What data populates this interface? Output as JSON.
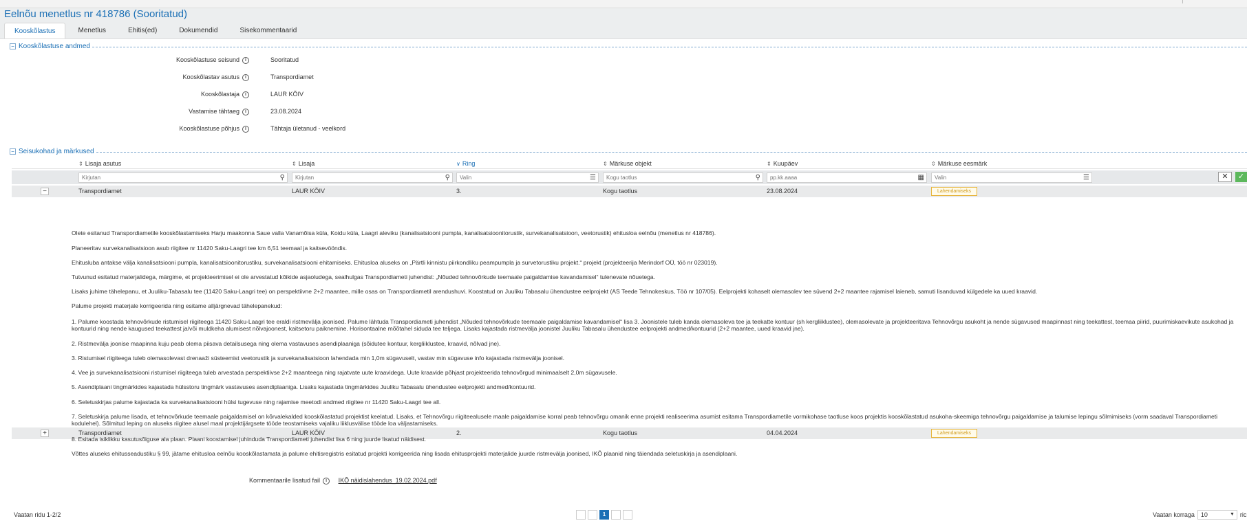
{
  "title": "Eelnõu menetlus nr 418786 (Sooritatud)",
  "tabs": [
    "Kooskõlastus",
    "Menetlus",
    "Ehitis(ed)",
    "Dokumendid",
    "Sisekommentaarid"
  ],
  "section1": {
    "title": "Kooskõlastuse andmed",
    "rows": [
      {
        "label": "Kooskõlastuse seisund",
        "value": "Sooritatud"
      },
      {
        "label": "Kooskõlastav asutus",
        "value": "Transpordiamet"
      },
      {
        "label": "Kooskõlastaja",
        "value": "LAUR KÕIV"
      },
      {
        "label": "Vastamise tähtaeg",
        "value": "23.08.2024"
      },
      {
        "label": "Kooskõlastuse põhjus",
        "value": "Tähtaja ületanud - veelkord"
      }
    ]
  },
  "section2": {
    "title": "Seisukohad ja märkused"
  },
  "columns": [
    "Lisaja asutus",
    "Lisaja",
    "Ring",
    "Märkuse objekt",
    "Kuupäev",
    "Märkuse eesmärk"
  ],
  "filters": [
    {
      "placeholder": "Kirjutan",
      "icon": "search-icon"
    },
    {
      "placeholder": "Kirjutan",
      "icon": "search-icon"
    },
    {
      "placeholder": "Valin",
      "icon": "list-icon"
    },
    {
      "placeholder": "Kogu taotlus",
      "icon": "search-icon"
    },
    {
      "placeholder": "pp.kk.aaaa",
      "icon": "calendar-icon"
    },
    {
      "placeholder": "Valin",
      "icon": "list-icon"
    }
  ],
  "rows": [
    {
      "toggle": "−",
      "asutus": "Transpordiamet",
      "lisaja": "LAUR KÕIV",
      "ring": "3.",
      "objekt": "Kogu taotlus",
      "kuupaev": "23.08.2024",
      "eesmark": "Lahendamiseks"
    },
    {
      "toggle": "+",
      "asutus": "Transpordiamet",
      "lisaja": "LAUR KÕIV",
      "ring": "2.",
      "objekt": "Kogu taotlus",
      "kuupaev": "04.04.2024",
      "eesmark": "Lahendamiseks"
    }
  ],
  "comment": [
    "Olete esitanud Transpordiametile kooskõlastamiseks Harju maakonna Saue valla Vanamõisa küla, Koidu küla, Laagri aleviku (kanalisatsiooni pumpla, kanalisatsioonitorustik, survekanalisatsioon, veetorustik) ehitusloa eelnõu (menetlus nr 418786).",
    "Planeeritav survekanalisatsioon asub riigitee nr 11420 Saku-Laagri tee km 6,51 teemaal ja kaitsevööndis.",
    "Ehitusluba antakse välja kanalisatsiooni pumpla, kanalisatsioonitorustiku, survekanalisatsiooni ehitamiseks. Ehitusloa aluseks on „Pärtli kinnistu piirkondliku peampumpla ja survetorustiku projekt.“ projekt (projekteerija Merindorf OÜ, töö nr 023019).",
    "Tutvunud esitatud materjalidega, märgime, et projekteerimisel ei ole arvestatud kõikide asjaoludega, sealhulgas Transpordiameti juhendist: „Nõuded tehnovõrkude teemaale paigaldamise kavandamisel“ tulenevate nõuetega.",
    "Lisaks juhime tähelepanu, et Juuliku-Tabasalu tee (11420 Saku-Laagri tee) on perspektiivne 2+2 maantee, mille osas on Transpordiametil arendushuvi. Koostatud on Juuliku Tabasalu ühendustee eelprojekt (AS Teede Tehnokeskus, Töö nr 107/05). Eelprojekti kohaselt olemasolev tee süvend 2+2 maantee rajamisel laieneb, samuti lisanduvad külgedele ka uued kraavid.",
    "Palume projekti materjale korrigeerida ning esitame alljärgnevad tähelepanekud:",
    "1.  Palume koostada tehnovõrkude ristumisel riigiteega 11420 Saku-Laagri tee eraldi ristmevälja joonised. Palume lähtuda Transpordiameti juhendist „Nõuded tehnovõrkude teemaale paigaldamise kavandamisel“ lisa 3. Joonistele tuleb kanda olemasoleva tee ja teekatte kontuur (sh kergliiklustee), olemasolevate ja projekteeritava Tehnovõrgu asukoht ja nende sügavused maapinnast ning teekattest, teemaa piirid, puurimiskaevikute asukohad ja kontuurid ning nende kaugused teekattest ja/või muldkeha alumisest nõlvajoonest, kaitsetoru paiknemine. Horisontaalne mõõtahel siduda tee teljega. Lisaks kajastada ristmevälja joonistel Juuliku Tabasalu ühendustee eelprojekti andmed/kontuurid (2+2 maantee, uued kraavid jne).",
    "2.  Ristmevälja joonise maapinna kuju peab olema piisava detailsusega ning olema vastavuses asendiplaaniga (sõidutee kontuur, kergliiklustee, kraavid, nõlvad jne).",
    "3.  Ristumisel riigiteega tuleb olemasolevast drenaaži süsteemist veetorustik ja survekanalisatsioon lahendada min 1,0m sügavuselt, vastav min sügavuse info kajastada ristmevälja joonisel.",
    "4.  Vee ja survekanalisatsiooni ristumisel riigiteega tuleb arvestada perspektiivse 2+2 maanteega ning rajatvate uute kraavidega. Uute kraavide põhjast projekteerida tehnovõrgud minimaalselt 2,0m sügavusele.",
    "5.  Asendiplaani tingmärkides kajastada hülsstoru tingmärk vastavuses asendiplaaniga. Lisaks kajastada tingmärkides Juuliku Tabasalu ühendustee eelprojekti andmed/kontuurid.",
    "6.  Seletuskirjas palume kajastada ka survekanalisatsiooni hülsi tugevuse ning rajamise meetodi andmed riigitee nr 11420 Saku-Laagri tee all.",
    "7.  Seletuskirja palume lisada, et tehnovõrkude teemaale paigaldamisel on kõrvalekalded kooskõlastatud projektist keelatud. Lisaks, et Tehnovõrgu riigiteealusele maale paigaldamise korral peab tehnovõrgu omanik enne projekti realiseerima asumist esitama Transpordiametile vormikohase taotluse koos projektis kooskõlastatud asukoha-skeemiga tehnovõrgu paigaldamise ja talumise lepingu sõlmimiseks (vorm saadaval Transpordiameti kodulehel). Sõlmitud leping on aluseks riigitee alusel maal projektijärgsete tööde teostamiseks vajaliku liiklusvälise tööde loa väljastamiseks.",
    "8.  Esitada isiklikku kasutusõiguse ala plaan. Plaani koostamisel juhinduda Transpordiameti juhendist lisa 6 ning juurde lisatud näidisest.",
    "Võttes aluseks ehitusseadustiku § 99, jätame ehitusloa eelnõu kooskõlastamata ja palume ehitisregistris esitatud projekti korrigeerida ning lisada ehitusprojekti materjalide juurde ristmevälja joonised, IKÕ plaanid ning täiendada seletuskirja ja asendiplaani."
  ],
  "attachment": {
    "label": "Kommentaarile lisatud fail",
    "file": "IKÕ näidislahendus_19.02.2024.pdf"
  },
  "footer": {
    "count": "Vaatan ridu 1-2/2",
    "page_current": "1",
    "page_size_label": "Vaatan korraga",
    "page_size": "10",
    "page_size_tail": "ric"
  },
  "colors": {
    "accent": "#1a6fb5",
    "badge": "#e6b43a",
    "confirm": "#5cb85c"
  }
}
